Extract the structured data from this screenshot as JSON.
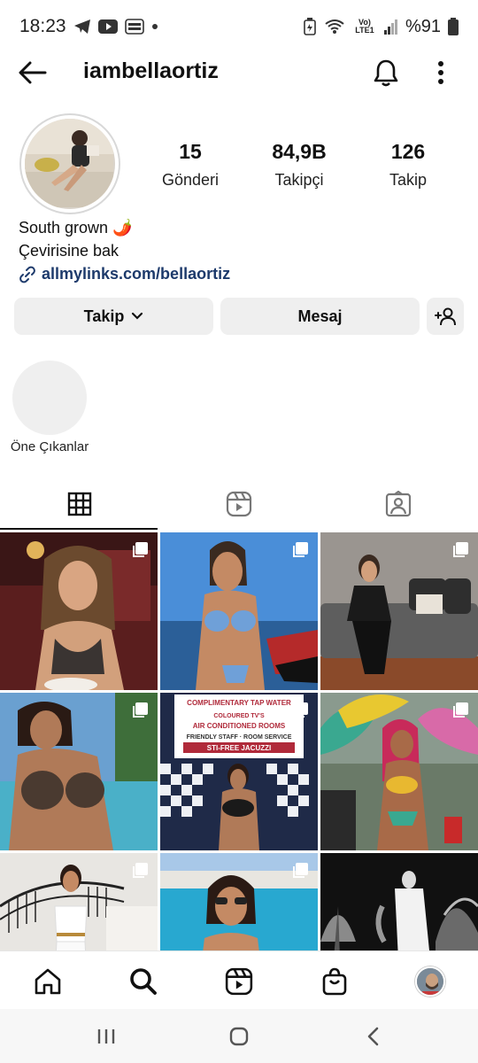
{
  "status_bar": {
    "time": "18:23",
    "network_label": "Vo) LTE1",
    "battery_text": "%91",
    "left_icons": [
      "telegram-icon",
      "youtube-icon",
      "blast-app-icon",
      "dot-icon"
    ],
    "right_icons": [
      "battery-saver-icon",
      "wifi-icon",
      "lte-icon",
      "signal-icon",
      "battery-icon"
    ]
  },
  "header": {
    "username": "iambellaortiz"
  },
  "profile": {
    "stats": [
      {
        "value": "15",
        "label": "Gönderi"
      },
      {
        "value": "84,9B",
        "label": "Takipçi"
      },
      {
        "value": "126",
        "label": "Takip"
      }
    ],
    "bio_text": "South grown 🌶️",
    "translate_label": "Çevirisine bak",
    "link_text": "allmylinks.com/bellaortiz"
  },
  "actions": {
    "follow_label": "Takip",
    "message_label": "Mesaj"
  },
  "highlights": {
    "label": "Öne Çıkanlar"
  },
  "tabs": [
    "grid-tab",
    "reels-tab",
    "tagged-tab"
  ],
  "grid_posts": [
    {
      "alt": "post-1",
      "multi": true
    },
    {
      "alt": "post-2",
      "multi": true
    },
    {
      "alt": "post-3",
      "multi": true
    },
    {
      "alt": "post-4",
      "multi": true
    },
    {
      "alt": "post-5",
      "multi": true
    },
    {
      "alt": "post-6",
      "multi": true
    },
    {
      "alt": "post-7",
      "multi": true
    },
    {
      "alt": "post-8",
      "multi": true
    },
    {
      "alt": "post-9",
      "multi": false
    }
  ],
  "post5_sign_lines": [
    "COMPLIMENTARY TAP WATER",
    "COLOURED TV'S",
    "AIR CONDITIONED ROOMS",
    "FRIENDLY STAFF · ROOM SERVICE",
    "STI-FREE JACUZZI"
  ],
  "colors": {
    "link": "#1d3a6b",
    "button_bg": "#efefef",
    "text": "#111111"
  }
}
